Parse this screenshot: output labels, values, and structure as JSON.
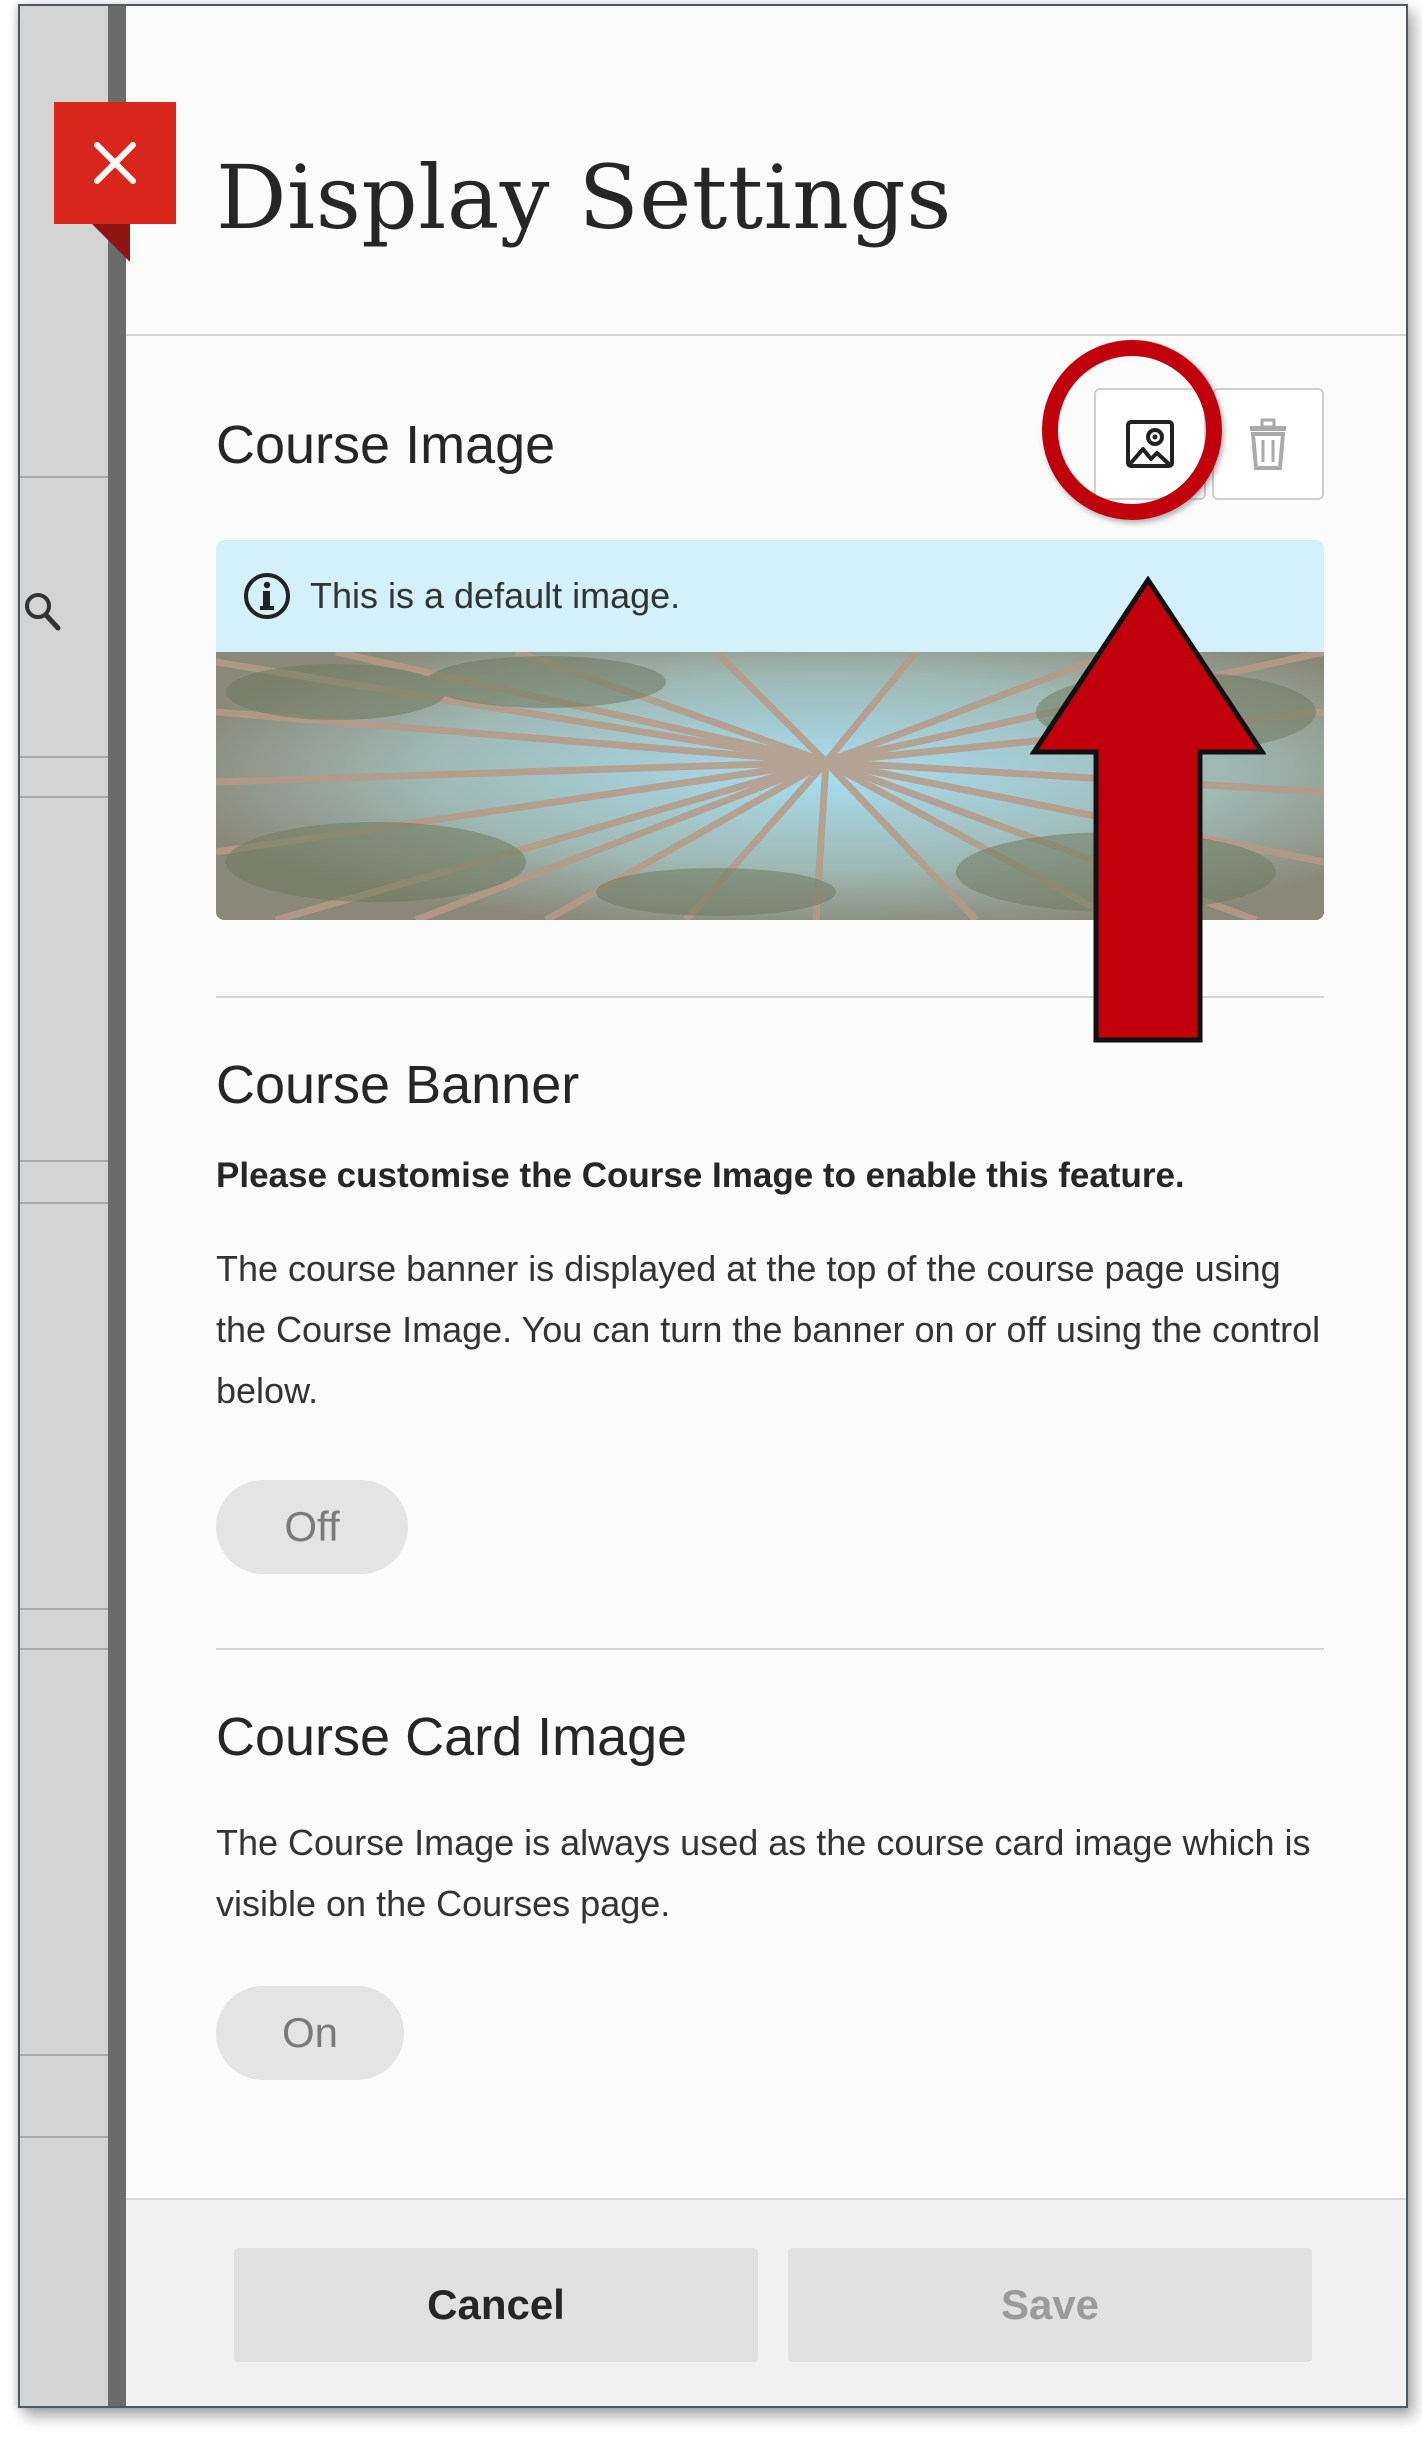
{
  "dialog": {
    "title": "Display Settings",
    "close_icon": "close-icon",
    "accent_color": "#d8261c"
  },
  "course_image": {
    "heading": "Course Image",
    "change_icon": "image-edit-icon",
    "delete_icon": "trash-icon",
    "info_icon": "info-icon",
    "info_text": "This is a default image.",
    "info_bg": "#d4f0fa",
    "image_subject": "forest-canopy-photo"
  },
  "course_banner": {
    "heading": "Course Banner",
    "warning": "Please customise the Course Image to enable this feature.",
    "description": "The course banner is displayed at the top of the course page using the Course Image. You can turn the banner on or off using the control below.",
    "toggle_label": "Off"
  },
  "course_card": {
    "heading": "Course Card Image",
    "description": "The Course Image is always used as the course card image which is visible on the Courses page.",
    "toggle_label": "On"
  },
  "footer": {
    "cancel_label": "Cancel",
    "save_label": "Save"
  },
  "annotation": {
    "highlight_color": "#c0000b",
    "arrow_icon": "up-arrow-annotation"
  },
  "background": {
    "search_icon": "search-icon"
  }
}
